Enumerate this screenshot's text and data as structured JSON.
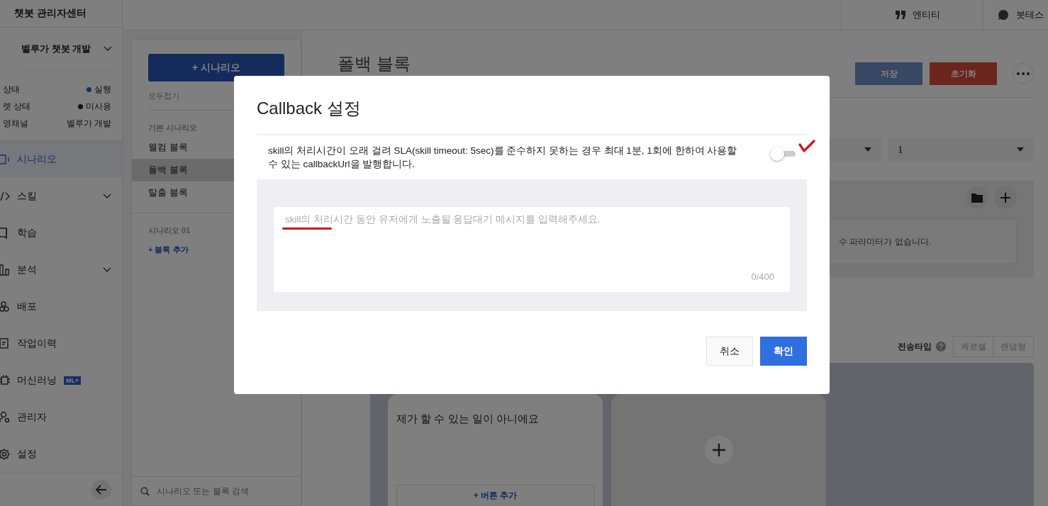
{
  "app_title": "챗봇 관리자센터",
  "header_actions": [
    {
      "label": "엔티티",
      "kind": "quote"
    },
    {
      "label": "봇테스",
      "kind": "chat"
    }
  ],
  "bot_selector": "벨루가 챗봇 개발",
  "bot_info": [
    {
      "label": "상태",
      "value": "실행",
      "kind": "running"
    },
    {
      "label": "렛 상태",
      "value": "미사용",
      "kind": "unused"
    },
    {
      "label": "영채널",
      "value": "벨루가 개발"
    }
  ],
  "nav": [
    {
      "label": "시나리오",
      "kind": "scenario",
      "selected": true,
      "expandable": false
    },
    {
      "label": "스킬",
      "kind": "code",
      "selected": false,
      "expandable": true
    },
    {
      "label": "학습",
      "kind": "book",
      "selected": false,
      "expandable": false
    },
    {
      "label": "분석",
      "kind": "chart",
      "selected": false,
      "expandable": true
    },
    {
      "label": "배포",
      "kind": "deploy",
      "selected": false,
      "expandable": false
    },
    {
      "label": "작업이력",
      "kind": "log",
      "selected": false,
      "expandable": false
    },
    {
      "label": "머신러닝",
      "kind": "chip",
      "selected": false,
      "expandable": false,
      "badge": "ML+"
    },
    {
      "label": "관리자",
      "kind": "admin",
      "selected": false,
      "expandable": false
    },
    {
      "label": "설정",
      "kind": "gear",
      "selected": false,
      "expandable": false
    }
  ],
  "scenario_panel": {
    "add_button": "+ 시나리오",
    "collapse_all": "모두접기",
    "groups": [
      {
        "title": "기본 시나리오",
        "blocks": [
          {
            "label": "웰컴 블록",
            "selected": false
          },
          {
            "label": "폴백 블록",
            "selected": true
          },
          {
            "label": "탈출 블록",
            "selected": false
          }
        ]
      },
      {
        "title": "시나리오 01",
        "add_block": "+ 블록 추가"
      }
    ],
    "search_placeholder": "시나리오 또는 블록 검색"
  },
  "editor": {
    "title": "폴백 블록",
    "save": "저장",
    "reset": "초기화",
    "select_value": "1",
    "params_empty": "수 파라미터가 없습니다.",
    "send_type": {
      "label": "전송타입",
      "options": [
        "케로셀",
        "랜덤형"
      ]
    },
    "card_text": "제가 할 수 있는 일이 아니에요",
    "card_button": "+ 버튼 추가"
  },
  "modal": {
    "title": "Callback 설정",
    "description": "skill의 처리시간이 오래 걸려 SLA(skill timeout: 5sec)를 준수하지 못하는 경우 최대 1분, 1회에 한하여 사용할 수 있는 callbackUrl을 발행합니다.",
    "enabled": false,
    "placeholder": "skill의 처리시간 동안 유저에게 노출될 응답대기 메시지를 입력해주세요.",
    "counter": "0/400",
    "buttons": [
      {
        "label": "취소",
        "kind": "secondary"
      },
      {
        "label": "확인",
        "kind": "primary"
      }
    ]
  }
}
